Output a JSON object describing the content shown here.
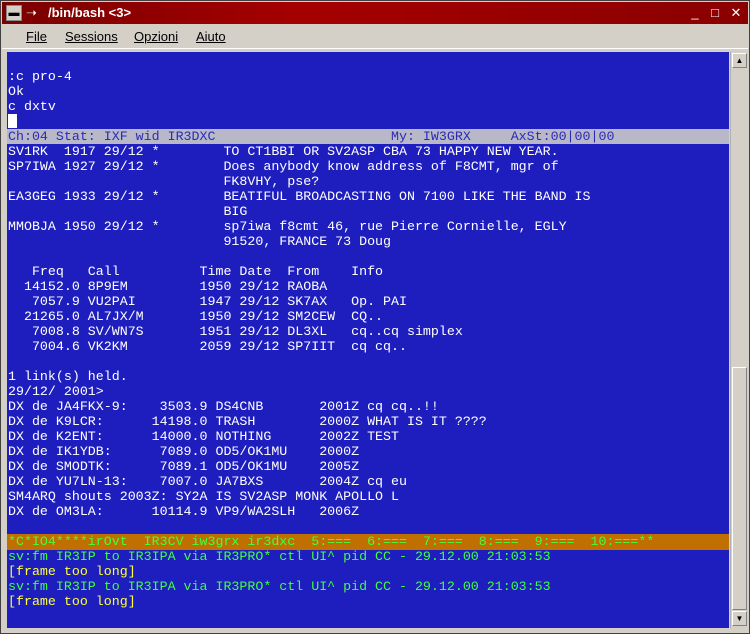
{
  "window": {
    "title": "/bin/bash <3>",
    "arrow": "➝"
  },
  "titlebar_buttons": {
    "minimize": "_",
    "maximize": "□",
    "close": "✕"
  },
  "menu": [
    "File",
    "Sessions",
    "Opzioni",
    "Aiuto"
  ],
  "terminal": {
    "top_lines": [
      ":c pro-4",
      "Ok",
      "c dxtv"
    ],
    "status_bar": "Ch:04 Stat: IXF wid IR3DXC                      My: IW3GRX     AxSt:00|00|00",
    "body_lines": [
      "SV1RK  1917 29/12 *        TO CT1BBI OR SV2ASP CBA 73 HAPPY NEW YEAR.",
      "SP7IWA 1927 29/12 *        Does anybody know address of F8CMT, mgr of",
      "                           FK8VHY, pse?",
      "EA3GEG 1933 29/12 *        BEATIFUL BROADCASTING ON 7100 LIKE THE BAND IS",
      "                           BIG",
      "MMOBJA 1950 29/12 *        sp7iwa f8cmt 46, rue Pierre Cornielle, EGLY",
      "                           91520, FRANCE 73 Doug",
      "",
      "   Freq   Call          Time Date  From    Info",
      "  14152.0 8P9EM         1950 29/12 RAOBA",
      "   7057.9 VU2PAI        1947 29/12 SK7AX   Op. PAI",
      "  21265.0 AL7JX/M       1950 29/12 SM2CEW  CQ..",
      "   7008.8 SV/WN7S       1951 29/12 DL3XL   cq..cq simplex",
      "   7004.6 VK2KM         2059 29/12 SP7IIT  cq cq..",
      "",
      "1 link(s) held.",
      "29/12/ 2001>",
      "DX de JA4FKX-9:    3503.9 DS4CNB       2001Z cq cq..!!",
      "DX de K9LCR:      14198.0 TRASH        2000Z WHAT IS IT ????",
      "DX de K2ENT:      14000.0 NOTHING      2002Z TEST",
      "DX de IK1YDB:      7089.0 OD5/OK1MU    2000Z",
      "DX de SMODTK:      7089.1 OD5/OK1MU    2005Z",
      "DX de YU7LN-13:    7007.0 JA7BXS       2004Z cq eu",
      "SM4ARQ shouts 2003Z: SY2A IS SV2ASP MONK APOLLO L",
      "DX de OM3LA:      10114.9 VP9/WA2SLH   2006Z"
    ],
    "orange_bar": "*C*IO4****irOvt  IR3CV iw3grx ir3dxc  5:===  6:===  7:===  8:===  9:===  10:===**",
    "bottom_lines": [
      "sv:fm IR3IP to IR3IPA via IR3PRO* ctl UI^ pid CC - 29.12.00 21:03:53",
      "[frame too long]",
      "sv:fm IR3IP to IR3IPA via IR3PRO* ctl UI^ pid CC - 29.12.00 21:03:53",
      "[frame too long]"
    ]
  },
  "scrollbar": {
    "up": "▲",
    "down": "▼"
  },
  "colors": {
    "terminal_bg": "#1e1ebe",
    "title_bg": "#a50000",
    "status_bg": "#b8b8c8",
    "status_bar_bg": "#c07000",
    "green_text": "#40ff40",
    "yellow_text": "#ffff40"
  }
}
